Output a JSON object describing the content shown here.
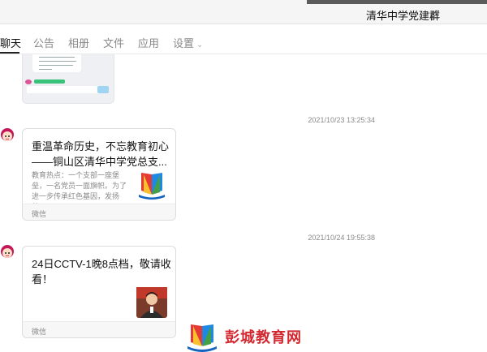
{
  "header": {
    "group_name": "清华中学党建群"
  },
  "tabs": [
    {
      "label": "聊天",
      "active": true
    },
    {
      "label": "公告"
    },
    {
      "label": "相册"
    },
    {
      "label": "文件"
    },
    {
      "label": "应用"
    },
    {
      "label": "设置"
    }
  ],
  "messages": [
    {
      "time": "2021/10/23 13:25:34",
      "title": "重温革命历史，不忘教育初心——铜山区清华中学党总支...",
      "desc": "教育热点：一个支部一座堡垒，一名党员一面旗帜。为了进一步传承红色基因，发扬革...",
      "source": "微信",
      "thumb_icon": "book-logo-icon"
    },
    {
      "time": "2021/10/24 19:55:38",
      "title": "24日CCTV-1晚8点档，敬请收看！",
      "desc": "",
      "source": "微信",
      "thumb_icon": "person-photo-icon"
    }
  ],
  "watermark": {
    "text": "彭城教育网"
  },
  "colors": {
    "watermark_red": "#d3282f",
    "accent_blue": "#2d84e8"
  }
}
